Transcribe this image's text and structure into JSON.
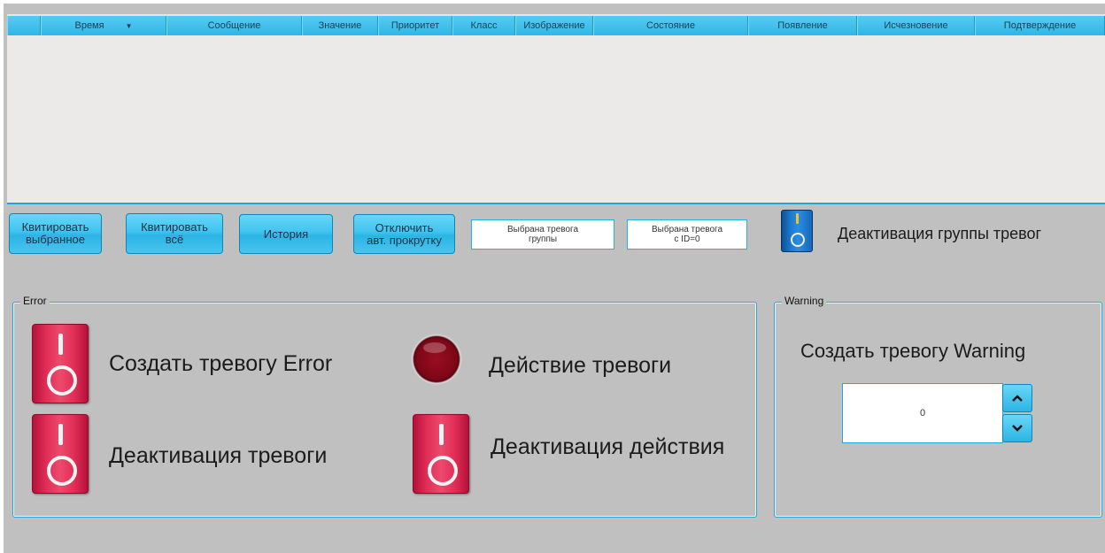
{
  "table": {
    "columns": [
      "",
      "Время",
      "Сообщение",
      "Значение",
      "Приоритет",
      "Класс",
      "Изображение",
      "Состояние",
      "Появление",
      "Исчезновение",
      "Подтверждение"
    ]
  },
  "buttons": {
    "ack_selected": [
      "Квитировать",
      "выбранное"
    ],
    "ack_all": [
      "Квитировать",
      "всё"
    ],
    "history": "История",
    "disable_autoscroll": [
      "Отключить",
      "авт. прокрутку"
    ]
  },
  "info": {
    "group_alarm": [
      "Выбрана тревога",
      "группы"
    ],
    "alarm_id": [
      "Выбрана тревога",
      "с ID=0"
    ]
  },
  "group_deactivation_label": "Деактивация группы тревог",
  "error_panel": {
    "title": "Error",
    "create_label": "Создать тревогу Error",
    "deactivate_label": "Деактивация тревоги",
    "action_label": "Действие тревоги",
    "action_deactivate_label": "Деактивация действия"
  },
  "warning_panel": {
    "title": "Warning",
    "create_label": "Создать тревогу Warning",
    "value": "0"
  },
  "colors": {
    "accent": "#30b6e6",
    "panel_bg": "#c0c0c0",
    "table_bg": "#ebeae8",
    "switch_red": "#e22e56",
    "switch_blue": "#1d7ad0"
  },
  "icons": {
    "sort": "chevron-down-icon",
    "up": "chevron-up-icon",
    "down": "chevron-down-icon"
  }
}
